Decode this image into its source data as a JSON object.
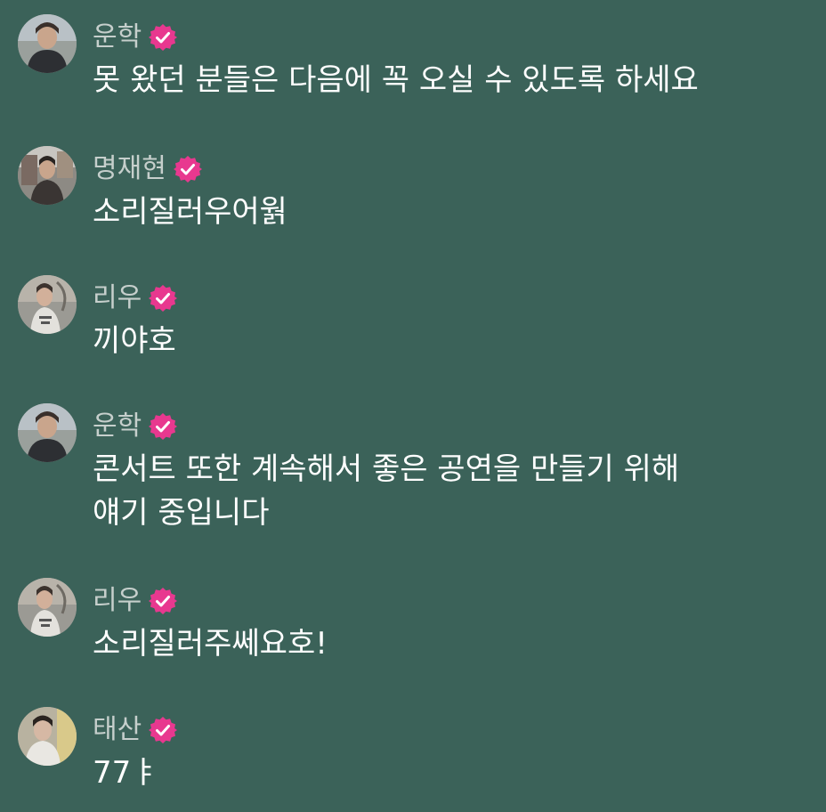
{
  "colors": {
    "background": "#3b6259",
    "name": "#c6cfcc",
    "message": "#ffffff",
    "badge": "#e8388f"
  },
  "messages": [
    {
      "name": "운학",
      "verified_icon": "verified-badge-icon",
      "avatar": "avatar-photo",
      "text": "못 왔던 분들은 다음에 꼭 오실 수 있도록 하세요"
    },
    {
      "name": "명재현",
      "verified_icon": "verified-badge-icon",
      "avatar": "avatar-photo",
      "text": "소리질러우어웕"
    },
    {
      "name": "리우",
      "verified_icon": "verified-badge-icon",
      "avatar": "avatar-photo",
      "text": "끼야호"
    },
    {
      "name": "운학",
      "verified_icon": "verified-badge-icon",
      "avatar": "avatar-photo",
      "text": "콘서트 또한 계속해서 좋은 공연을 만들기 위해\n얘기 중입니다"
    },
    {
      "name": "리우",
      "verified_icon": "verified-badge-icon",
      "avatar": "avatar-photo",
      "text": "소리질러주쎄요호!"
    },
    {
      "name": "태산",
      "verified_icon": "verified-badge-icon",
      "avatar": "avatar-photo",
      "text": "77ㅑ"
    }
  ]
}
